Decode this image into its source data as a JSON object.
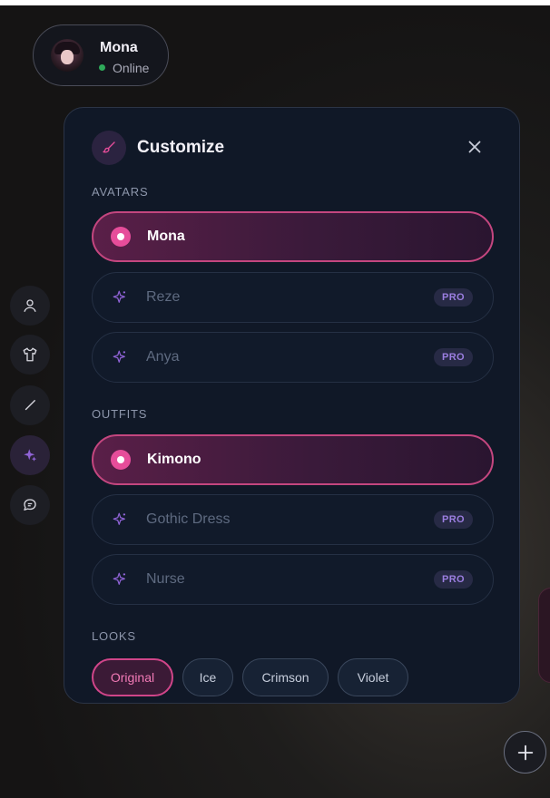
{
  "profile": {
    "name": "Mona",
    "status": "Online",
    "status_color": "#2faa5a"
  },
  "side_rail": {
    "items": [
      {
        "icon": "user-icon"
      },
      {
        "icon": "shirt-icon"
      },
      {
        "icon": "brush-icon"
      },
      {
        "icon": "sparkle-icon",
        "active": true
      },
      {
        "icon": "chat-icon"
      }
    ]
  },
  "panel": {
    "title": "Customize",
    "header_icon": "paintbrush-icon",
    "close_icon": "close-icon",
    "avatars_label": "AVATARS",
    "avatars": [
      {
        "label": "Mona",
        "selected": true
      },
      {
        "label": "Reze",
        "badge": "PRO"
      },
      {
        "label": "Anya",
        "badge": "PRO"
      }
    ],
    "outfits_label": "OUTFITS",
    "outfits": [
      {
        "label": "Kimono",
        "selected": true
      },
      {
        "label": "Gothic Dress",
        "badge": "PRO"
      },
      {
        "label": "Nurse",
        "badge": "PRO"
      }
    ],
    "looks_label": "LOOKS",
    "looks": [
      {
        "label": "Original",
        "selected": true
      },
      {
        "label": "Ice"
      },
      {
        "label": "Crimson"
      },
      {
        "label": "Violet"
      }
    ]
  },
  "fab": {
    "icon": "plus-icon"
  },
  "colors": {
    "accent": "#e64d9a",
    "pro_badge_text": "#9b7ee0",
    "panel_bg": "#101827"
  }
}
